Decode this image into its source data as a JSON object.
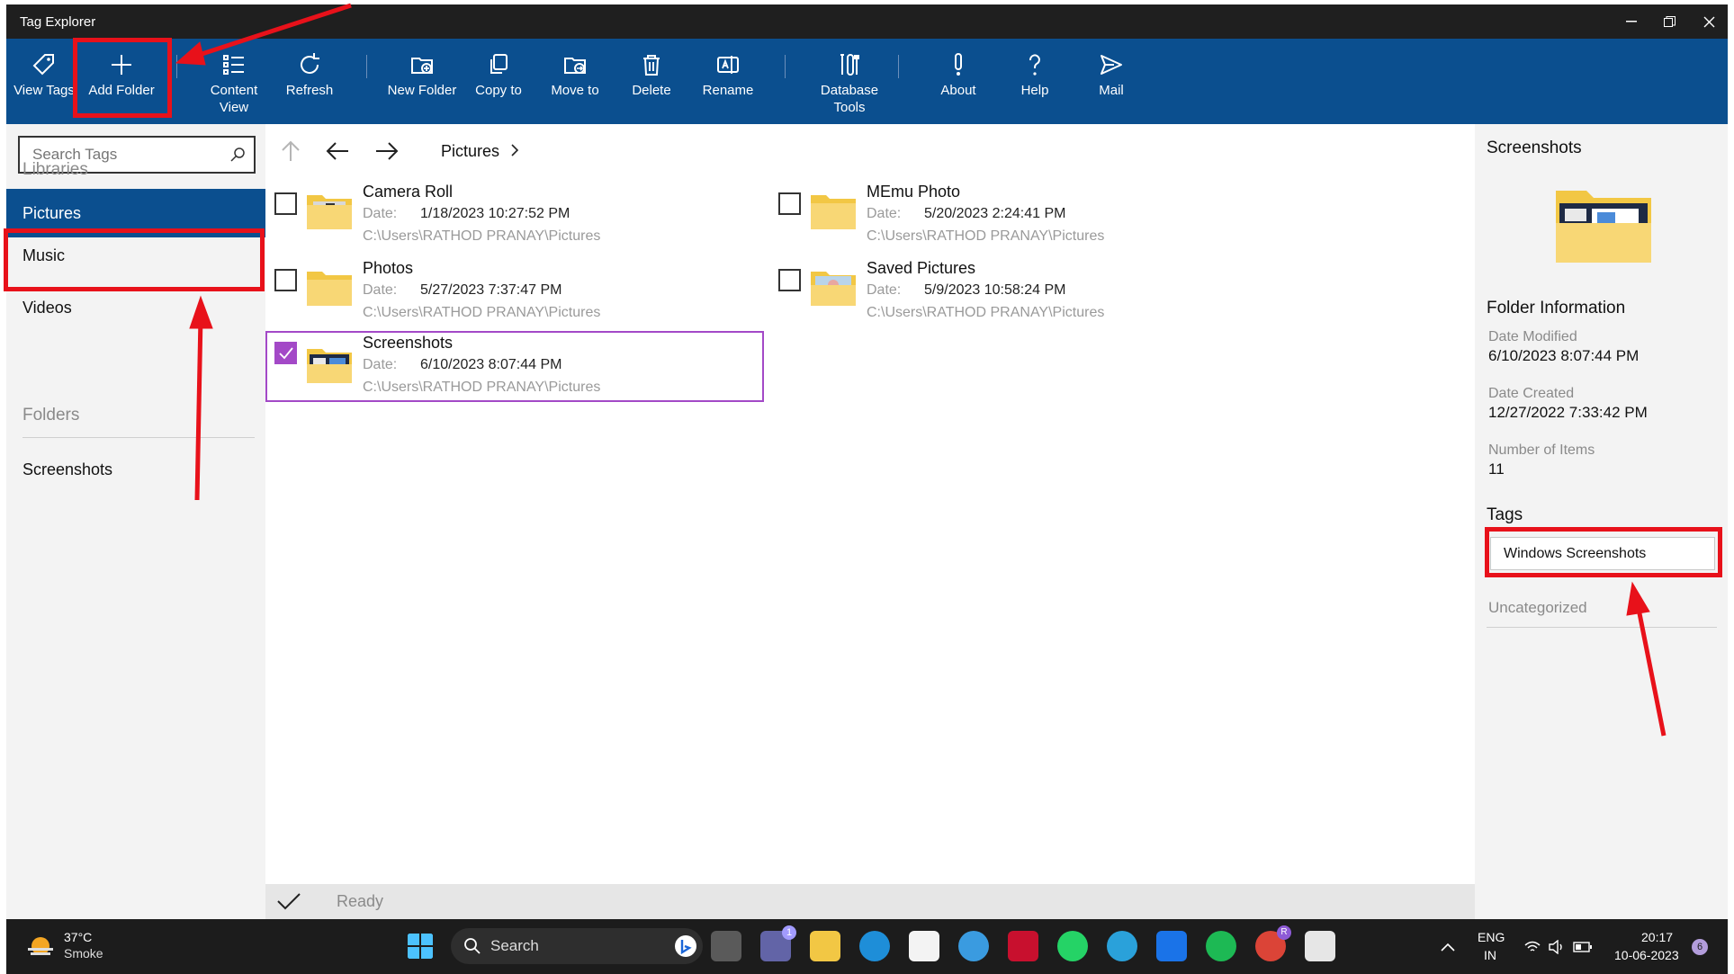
{
  "window": {
    "title": "Tag Explorer"
  },
  "ribbon": {
    "buttons": [
      {
        "label": "View Tags",
        "icon": "tag-icon"
      },
      {
        "label": "Add Folder",
        "icon": "plus-icon"
      },
      {
        "label": "Content View",
        "icon": "list-icon"
      },
      {
        "label": "Refresh",
        "icon": "refresh-icon"
      },
      {
        "label": "New Folder",
        "icon": "new-folder-icon"
      },
      {
        "label": "Copy to",
        "icon": "copy-icon"
      },
      {
        "label": "Move to",
        "icon": "move-folder-icon"
      },
      {
        "label": "Delete",
        "icon": "trash-icon"
      },
      {
        "label": "Rename",
        "icon": "rename-icon"
      },
      {
        "label": "Database Tools",
        "icon": "database-tools-icon"
      },
      {
        "label": "About",
        "icon": "exclamation-icon"
      },
      {
        "label": "Help",
        "icon": "question-icon"
      },
      {
        "label": "Mail",
        "icon": "send-icon"
      }
    ]
  },
  "sidebar": {
    "search_placeholder": "Search Tags",
    "libraries_header": "Libraries",
    "items": [
      {
        "label": "Pictures",
        "selected": true
      },
      {
        "label": "Music",
        "selected": false
      },
      {
        "label": "Videos",
        "selected": false
      }
    ],
    "folders_header": "Folders",
    "folders": [
      {
        "label": "Screenshots"
      }
    ]
  },
  "main": {
    "breadcrumb": "Pictures",
    "date_label": "Date:",
    "items": [
      {
        "name": "Camera Roll",
        "date": "1/18/2023 10:27:52 PM",
        "path": "C:\\Users\\RATHOD PRANAY\\Pictures",
        "checked": false
      },
      {
        "name": "MEmu Photo",
        "date": "5/20/2023 2:24:41 PM",
        "path": "C:\\Users\\RATHOD PRANAY\\Pictures",
        "checked": false
      },
      {
        "name": "Photos",
        "date": "5/27/2023 7:37:47 PM",
        "path": "C:\\Users\\RATHOD PRANAY\\Pictures",
        "checked": false
      },
      {
        "name": "Saved Pictures",
        "date": "5/9/2023 10:58:24 PM",
        "path": "C:\\Users\\RATHOD PRANAY\\Pictures",
        "checked": false
      },
      {
        "name": "Screenshots",
        "date": "6/10/2023 8:07:44 PM",
        "path": "C:\\Users\\RATHOD PRANAY\\Pictures",
        "checked": true
      }
    ],
    "status": "Ready"
  },
  "details": {
    "title": "Screenshots",
    "info_header": "Folder Information",
    "date_modified_label": "Date Modified",
    "date_modified": "6/10/2023 8:07:44 PM",
    "date_created_label": "Date Created",
    "date_created": "12/27/2022 7:33:42 PM",
    "items_label": "Number of Items",
    "items_count": "11",
    "tags_header": "Tags",
    "tag": "Windows Screenshots",
    "uncategorized": "Uncategorized"
  },
  "taskbar": {
    "weather_temp": "37°C",
    "weather_desc": "Smoke",
    "search_label": "Search",
    "lang": "ENG",
    "region": "IN",
    "time": "20:17",
    "date": "10-06-2023",
    "notification_count": "6",
    "teams_badge": "1",
    "chrome_badge": "R"
  },
  "colors": {
    "ribbon": "#0b4f8f",
    "selection": "#0b4f8f",
    "checkbox_checked": "#a349c7",
    "annotation": "#e8111a"
  }
}
